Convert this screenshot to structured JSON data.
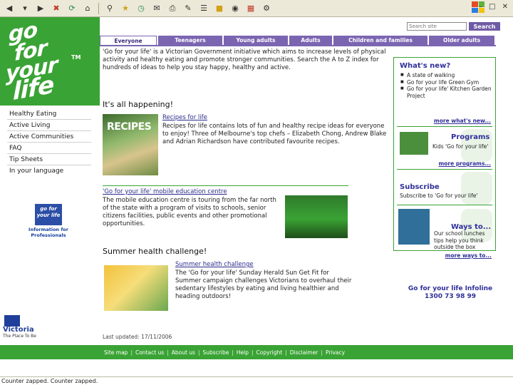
{
  "search": {
    "placeholder": "Search site",
    "button_label": "Search"
  },
  "tabs": [
    {
      "label": "Everyone"
    },
    {
      "label": "Teenagers"
    },
    {
      "label": "Young adults"
    },
    {
      "label": "Adults"
    },
    {
      "label": "Children and families"
    },
    {
      "label": "Older adults"
    }
  ],
  "logo": {
    "line1": "go",
    "line2": "for",
    "line3": "your",
    "line4": "life",
    "tm": "TM"
  },
  "left_nav": [
    {
      "label": "Healthy Eating"
    },
    {
      "label": "Active Living"
    },
    {
      "label": "Active Communities"
    },
    {
      "label": "FAQ"
    },
    {
      "label": "Tip Sheets"
    },
    {
      "label": "In your language"
    }
  ],
  "professionals": {
    "logo_text": "go for your life",
    "label": "Information for Professionals"
  },
  "victoria": {
    "name": "Victoria",
    "tagline": "The Place To Be"
  },
  "main": {
    "intro": "'Go for your life' is a Victorian Government initiative which aims to increase levels of physical activity and healthy eating and promote stronger communities. Search the A to Z index for hundreds of ideas to help you stay happy, healthy and active.",
    "happening_heading": "It's all happening!",
    "recipes": {
      "image_label": "RECIPES",
      "title": "Recipes for life",
      "text": "Recipes for life contains lots of fun and healthy recipe ideas for everyone to enjoy! Three of Melbourne's top chefs – Elizabeth Chong, Andrew Blake and Adrian Richardson have contributed favourite recipes."
    },
    "mobile": {
      "title": "'Go for your life' mobile education centre",
      "text": "The mobile education centre is touring from the far north of the state with a program of visits to schools, senior citizens facilities, public events and other promotional opportunities."
    },
    "summer_heading": "Summer health challenge!",
    "summer": {
      "title": "Summer health challenge",
      "text": "The 'Go for your life' Sunday Herald Sun Get Fit for Summer campaign challenges Victorians to overhaul their sedentary lifestyles by eating and living healthier and heading outdoors!"
    },
    "last_updated": "Last updated: 17/11/2006"
  },
  "sidebar": {
    "whats_new": {
      "heading": "What's new?",
      "items": [
        {
          "label": "A state of walking"
        },
        {
          "label": "Go for your life Green Gym"
        },
        {
          "label": "Go for your life' Kitchen Garden Project"
        }
      ],
      "more": "more what's new..."
    },
    "programs": {
      "heading": "Programs",
      "text": "Kids 'Go for your life'",
      "more": "more programs..."
    },
    "subscribe": {
      "heading": "Subscribe",
      "text": "Subscribe to 'Go for your life'"
    },
    "ways": {
      "heading": "Ways to...",
      "text": "Our school lunches tips help you think outside the box",
      "more": "more ways to..."
    },
    "infoline": {
      "title": "Go for your life Infoline",
      "phone": "1300 73 98 99"
    }
  },
  "footer": [
    {
      "label": "Site map"
    },
    {
      "label": "Contact us"
    },
    {
      "label": "About us"
    },
    {
      "label": "Subscribe"
    },
    {
      "label": "Help"
    },
    {
      "label": "Copyright"
    },
    {
      "label": "Disclaimer"
    },
    {
      "label": "Privacy"
    }
  ],
  "status_bar": "Counter zapped. Counter zapped.",
  "colors": {
    "brand_green": "#3aa335",
    "tab_purple": "#7b65b1",
    "link_blue": "#2f2f9a"
  }
}
